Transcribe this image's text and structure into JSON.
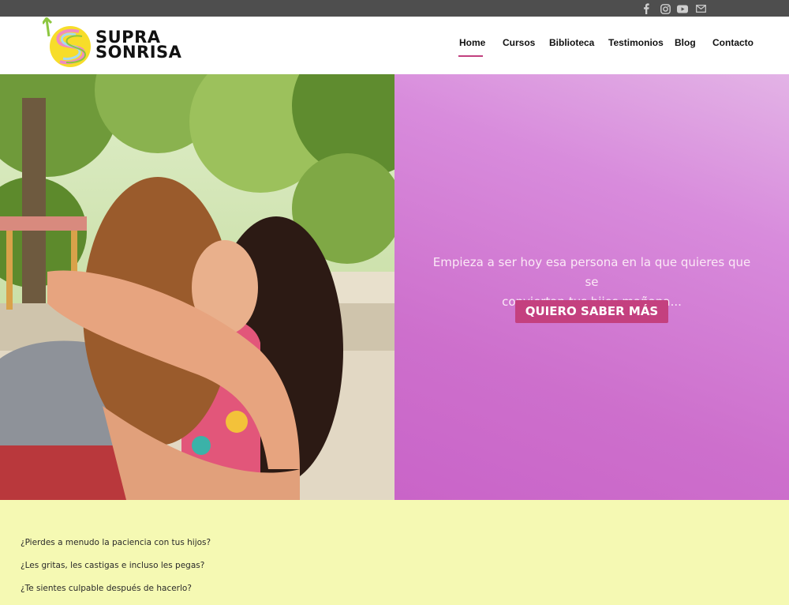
{
  "topbar": {
    "icons": [
      "facebook-icon",
      "instagram-icon",
      "youtube-icon",
      "mail-icon"
    ],
    "background": "#4e4e4e"
  },
  "logo": {
    "line1": "SUPRA",
    "line2": "SONRISA"
  },
  "nav": {
    "items": [
      "Home",
      "Cursos",
      "Biblioteca",
      "Testimonios",
      "Blog",
      "Contacto"
    ],
    "active": "Home",
    "accent": "#c2407f"
  },
  "hero": {
    "text_line1": "Empieza a ser hoy esa persona en la que quieres que se",
    "text_line2": "conviertan tus hijos mañana...",
    "cta_label": "QUIERO SABER MÁS",
    "panel_color": "#d27ad3",
    "cta_color": "#c4407f"
  },
  "bottom": {
    "background": "#f5f9b3",
    "questions": [
      "¿Pierdes a menudo la paciencia con tus hijos?",
      "¿Les gritas, les castigas e incluso les pegas?",
      "¿Te sientes culpable después de hacerlo?"
    ]
  }
}
